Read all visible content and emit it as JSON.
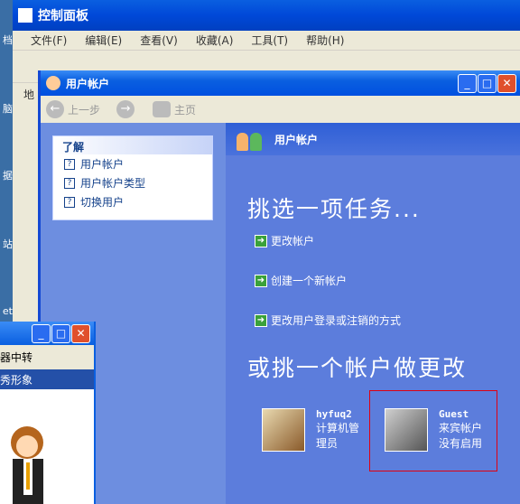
{
  "desktop": {
    "labels": [
      "档",
      "脑",
      "据",
      "站",
      "et"
    ]
  },
  "control_panel": {
    "title": "控制面板",
    "menu": [
      "文件(F)",
      "编辑(E)",
      "查看(V)",
      "收藏(A)",
      "工具(T)",
      "帮助(H)"
    ],
    "address_label": "地"
  },
  "user_accounts": {
    "title": "用户帐户",
    "nav": {
      "back": "上一步",
      "home": "主页"
    },
    "learn": {
      "header": "了解",
      "items": [
        "用户帐户",
        "用户帐户类型",
        "切换用户"
      ]
    },
    "section_header": "用户帐户",
    "pick_task": "挑选一项任务...",
    "tasks": [
      "更改帐户",
      "创建一个新帐户",
      "更改用户登录或注销的方式"
    ],
    "pick_account": "或挑一个帐户做更改",
    "accounts": [
      {
        "name": "hyfuq2",
        "line1": "计算机管",
        "line2": "理员"
      },
      {
        "name": "Guest",
        "line1": "来宾帐户",
        "line2": "没有启用"
      }
    ]
  },
  "qq_window": {
    "line1": "器中转",
    "line2": "秀形象"
  },
  "colors": {
    "accent": "#0a5fe0",
    "highlight": "#e00010"
  }
}
